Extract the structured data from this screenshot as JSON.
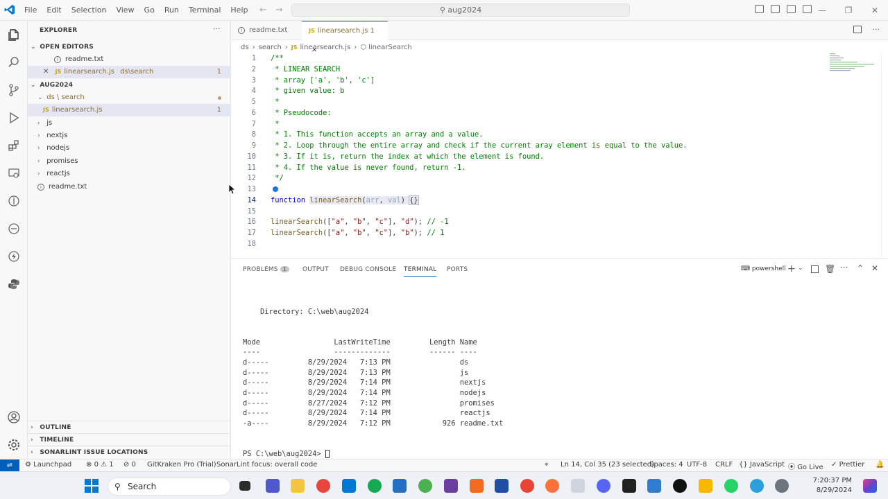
{
  "titlebar": {
    "menu": [
      "File",
      "Edit",
      "Selection",
      "View",
      "Go",
      "Run",
      "Terminal",
      "Help"
    ],
    "search": "aug2024",
    "window_controls": {
      "minimize": "—",
      "restore": "❐",
      "close": "✕"
    }
  },
  "activity": {
    "icons": [
      "explorer-icon",
      "search-icon",
      "source-control-icon",
      "run-debug-icon",
      "extensions-icon",
      "remote-explorer-icon",
      "gitlens-icon",
      "liveshare-icon",
      "thunder-icon",
      "python-icon",
      "account-icon",
      "manage-icon"
    ]
  },
  "sidebar": {
    "title": "EXPLORER",
    "more": "···",
    "open_editors_header": "OPEN EDITORS",
    "open_editors": [
      {
        "name": "readme.txt",
        "path": ""
      },
      {
        "name": "linearsearch.js",
        "path": "ds\\search",
        "badge": "1",
        "close": "✕"
      }
    ],
    "folder_header": "AUG2024",
    "tree": [
      {
        "label": "ds \\ search",
        "expanded": true
      },
      {
        "label": "linearsearch.js",
        "badge": "1"
      },
      {
        "label": "js"
      },
      {
        "label": "nextjs"
      },
      {
        "label": "nodejs"
      },
      {
        "label": "promises"
      },
      {
        "label": "reactjs"
      },
      {
        "label": "readme.txt"
      }
    ],
    "outline": "OUTLINE",
    "timeline": "TIMELINE",
    "sonarlint": "SONARLINT ISSUE LOCATIONS"
  },
  "tabs": [
    {
      "label": "readme.txt"
    },
    {
      "label": "linearsearch.js",
      "badge": "1",
      "close": "✕"
    }
  ],
  "breadcrumb": {
    "p1": "ds",
    "p2": "search",
    "p3": "linearsearch.js",
    "p4": "linearSearch",
    "sep": "›"
  },
  "editor": {
    "line_numbers": [
      "1",
      "2",
      "3",
      "4",
      "5",
      "6",
      "7",
      "8",
      "9",
      "10",
      "11",
      "12",
      "13",
      "14",
      "15",
      "16",
      "17",
      "18"
    ],
    "lines": [
      "/**",
      " * LINEAR SEARCH",
      " * array ['a', 'b', 'c']",
      " * given value: b",
      " *",
      " * Pseudocode:",
      " *",
      " * 1. This function accepts an array and a value.",
      " * 2. Loop through the entire array and check if the current aray element is equal to the value.",
      " * 3. If it is, return the index at which the element is found.",
      " * 4. If the value is never found, return -1.",
      " */",
      "",
      "",
      "",
      "",
      "",
      ""
    ],
    "line14": {
      "kw": "function",
      "fn": "linearSearch",
      "p1": "arr",
      "p2": "val",
      "rest": "{}"
    },
    "line16": {
      "fn": "linearSearch",
      "a": "\"a\"",
      "b": "\"b\"",
      "c": "\"c\"",
      "arg": "\"d\"",
      "comment": "// -1"
    },
    "line17": {
      "fn": "linearSearch",
      "a": "\"a\"",
      "b": "\"b\"",
      "c": "\"c\"",
      "arg": "\"b\"",
      "comment": "// 1"
    }
  },
  "panel": {
    "tabs": [
      "PROBLEMS",
      "OUTPUT",
      "DEBUG CONSOLE",
      "TERMINAL",
      "PORTS"
    ],
    "problems_count": "1",
    "shell": "powershell",
    "terminal": {
      "directory": "    Directory: C:\\web\\aug2024",
      "header": "Mode                 LastWriteTime         Length Name",
      "underline": "----                 -------------         ------ ----",
      "rows": [
        "d-----         8/29/2024   7:13 PM                ds",
        "d-----         8/29/2024   7:13 PM                js",
        "d-----         8/29/2024   7:14 PM                nextjs",
        "d-----         8/29/2024   7:14 PM                nodejs",
        "d-----         8/27/2024   7:12 PM                promises",
        "d-----         8/29/2024   7:14 PM                reactjs",
        "-a----         8/29/2024   7:12 PM            926 readme.txt"
      ],
      "prompt": "PS C:\\web\\aug2024> "
    }
  },
  "status": {
    "launchpad": "Launchpad",
    "errors": "0",
    "warnings": "1",
    "ports": "0",
    "gitkraken": "GitKraken Pro (Trial)",
    "sonarlint": "SonarLint focus: overall code",
    "position": "Ln 14, Col 35 (23 selected)",
    "spaces": "Spaces: 4",
    "encoding": "UTF-8",
    "eol": "CRLF",
    "language": "JavaScript",
    "golive": "Go Live",
    "prettier": "Prettier"
  },
  "taskbar": {
    "search": "Search",
    "time": "7:20:37 PM",
    "date": "8/29/2024"
  },
  "colors": {
    "accent": "#005fb8",
    "js_yellow": "#c9a400",
    "warning": "#8a6d3b"
  }
}
